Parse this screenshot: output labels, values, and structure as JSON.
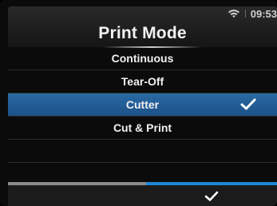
{
  "header": {
    "title": "Print Mode",
    "time": "09:53",
    "wifi_icon": "wifi-icon"
  },
  "menu": {
    "items": [
      {
        "label": "Continuous",
        "selected": false
      },
      {
        "label": "Tear-Off",
        "selected": false
      },
      {
        "label": "Cutter",
        "selected": true
      },
      {
        "label": "Cut & Print",
        "selected": false
      }
    ],
    "selected_index": 2,
    "selected_color": "#2a6aa3"
  },
  "footer": {
    "left_button": "back",
    "right_button": "confirm",
    "right_accent_color": "#1f86d7"
  }
}
